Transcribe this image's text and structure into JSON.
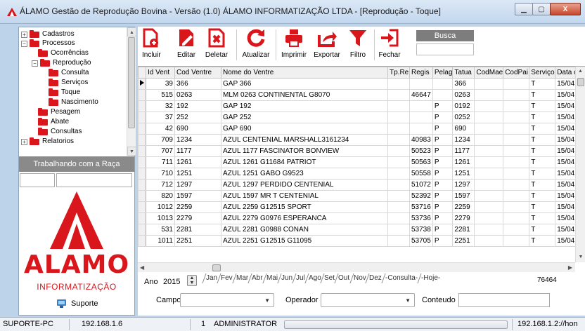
{
  "window": {
    "title": "ÁLAMO Gestão de Reprodução Bovina - Versão (1.0) ÁLAMO INFORMATIZAÇÃO LTDA - [Reprodução - Toque]",
    "minimize": "▁",
    "maximize": "▢",
    "close": "X"
  },
  "tree": {
    "items": [
      {
        "label": "Cadastros",
        "expander": "+"
      },
      {
        "label": "Processos",
        "expander": "−"
      },
      {
        "label": "Ocorrências"
      },
      {
        "label": "Reprodução",
        "expander": "−"
      },
      {
        "label": "Consulta"
      },
      {
        "label": "Serviços"
      },
      {
        "label": "Toque"
      },
      {
        "label": "Nascimento"
      },
      {
        "label": "Pesagem"
      },
      {
        "label": "Abate"
      },
      {
        "label": "Consultas"
      },
      {
        "label": "Relatorios",
        "expander": "+"
      }
    ]
  },
  "raca": {
    "label": "Trabalhando com a Raça"
  },
  "logo": {
    "name": "ALAMO",
    "subtitle": "INFORMATIZAÇÃO"
  },
  "support": {
    "label": "Suporte"
  },
  "toolbar": {
    "incluir": "Incluir",
    "editar": "Editar",
    "deletar": "Deletar",
    "atualizar": "Atualizar",
    "imprimir": "Imprimir",
    "exportar": "Exportar",
    "filtro": "Filtro",
    "fechar": "Fechar",
    "busca": "Busca"
  },
  "grid": {
    "columns": [
      "Id Vent",
      "Cod Ventre",
      "Nome do Ventre",
      "Tp.Re",
      "Regis",
      "Pelag",
      "Tatua",
      "CodMae",
      "CodPai",
      "Serviço",
      "Data d"
    ],
    "rows": [
      [
        "39",
        "366",
        "GAP 366",
        "",
        "",
        "",
        "366",
        "",
        "",
        "T",
        "15/04,"
      ],
      [
        "515",
        "0263",
        "MLM 0263 CONTINENTAL G8070",
        "",
        "46647",
        "",
        "0263",
        "",
        "",
        "T",
        "15/04,"
      ],
      [
        "32",
        "192",
        "GAP 192",
        "",
        "",
        "P",
        "0192",
        "",
        "",
        "T",
        "15/04,"
      ],
      [
        "37",
        "252",
        "GAP 252",
        "",
        "",
        "P",
        "0252",
        "",
        "",
        "T",
        "15/04,"
      ],
      [
        "42",
        "690",
        "GAP 690",
        "",
        "",
        "P",
        "690",
        "",
        "",
        "T",
        "15/04,"
      ],
      [
        "709",
        "1234",
        "AZUL CENTENIAL MARSHALL3161234",
        "",
        "40983",
        "P",
        "1234",
        "",
        "",
        "T",
        "15/04,"
      ],
      [
        "707",
        "1177",
        "AZUL 1177 FASCINATOR BONVIEW",
        "",
        "50523",
        "P",
        "1177",
        "",
        "",
        "T",
        "15/04,"
      ],
      [
        "711",
        "1261",
        "AZUL 1261 G11684 PATRIOT",
        "",
        "50563",
        "P",
        "1261",
        "",
        "",
        "T",
        "15/04,"
      ],
      [
        "710",
        "1251",
        "AZUL 1251 GABO G9523",
        "",
        "50558",
        "P",
        "1251",
        "",
        "",
        "T",
        "15/04,"
      ],
      [
        "712",
        "1297",
        "AZUL 1297 PERDIDO CENTENIAL",
        "",
        "51072",
        "P",
        "1297",
        "",
        "",
        "T",
        "15/04,"
      ],
      [
        "820",
        "1597",
        "AZUL 1597 MR T CENTENIAL",
        "",
        "52392",
        "P",
        "1597",
        "",
        "",
        "T",
        "15/04,"
      ],
      [
        "1012",
        "2259",
        "AZUL 2259 G12515 SPORT",
        "",
        "53716",
        "P",
        "2259",
        "",
        "",
        "T",
        "15/04,"
      ],
      [
        "1013",
        "2279",
        "AZUL 2279 G0976 ESPERANCA",
        "",
        "53736",
        "P",
        "2279",
        "",
        "",
        "T",
        "15/04,"
      ],
      [
        "531",
        "2281",
        "AZUL 2281 G0988 CONAN",
        "",
        "53738",
        "P",
        "2281",
        "",
        "",
        "T",
        "15/04,"
      ],
      [
        "1011",
        "2251",
        "AZUL 2251 G12515 G11095",
        "",
        "53705",
        "P",
        "2251",
        "",
        "",
        "T",
        "15/04,"
      ]
    ]
  },
  "ano": {
    "label": "Ano",
    "value": "2015"
  },
  "months": [
    "Jan",
    "Fev",
    "Mar",
    "Abr",
    "Mai",
    "Jun",
    "Jul",
    "Ago",
    "Set",
    "Out",
    "Nov",
    "Dez",
    "-Consulta-",
    "-Hoje-"
  ],
  "record_count": "76464",
  "filter": {
    "campo_label": "Campo",
    "operador_label": "Operador",
    "conteudo_label": "Conteudo"
  },
  "status": {
    "host": "SUPORTE-PC",
    "ip": "192.168.1.6",
    "user_id": "1",
    "user": "ADMINISTRATOR",
    "server": "192.168.1.2://hon"
  },
  "colors": {
    "accent_red": "#d8161b",
    "title_bg": "#c2d7ee"
  }
}
